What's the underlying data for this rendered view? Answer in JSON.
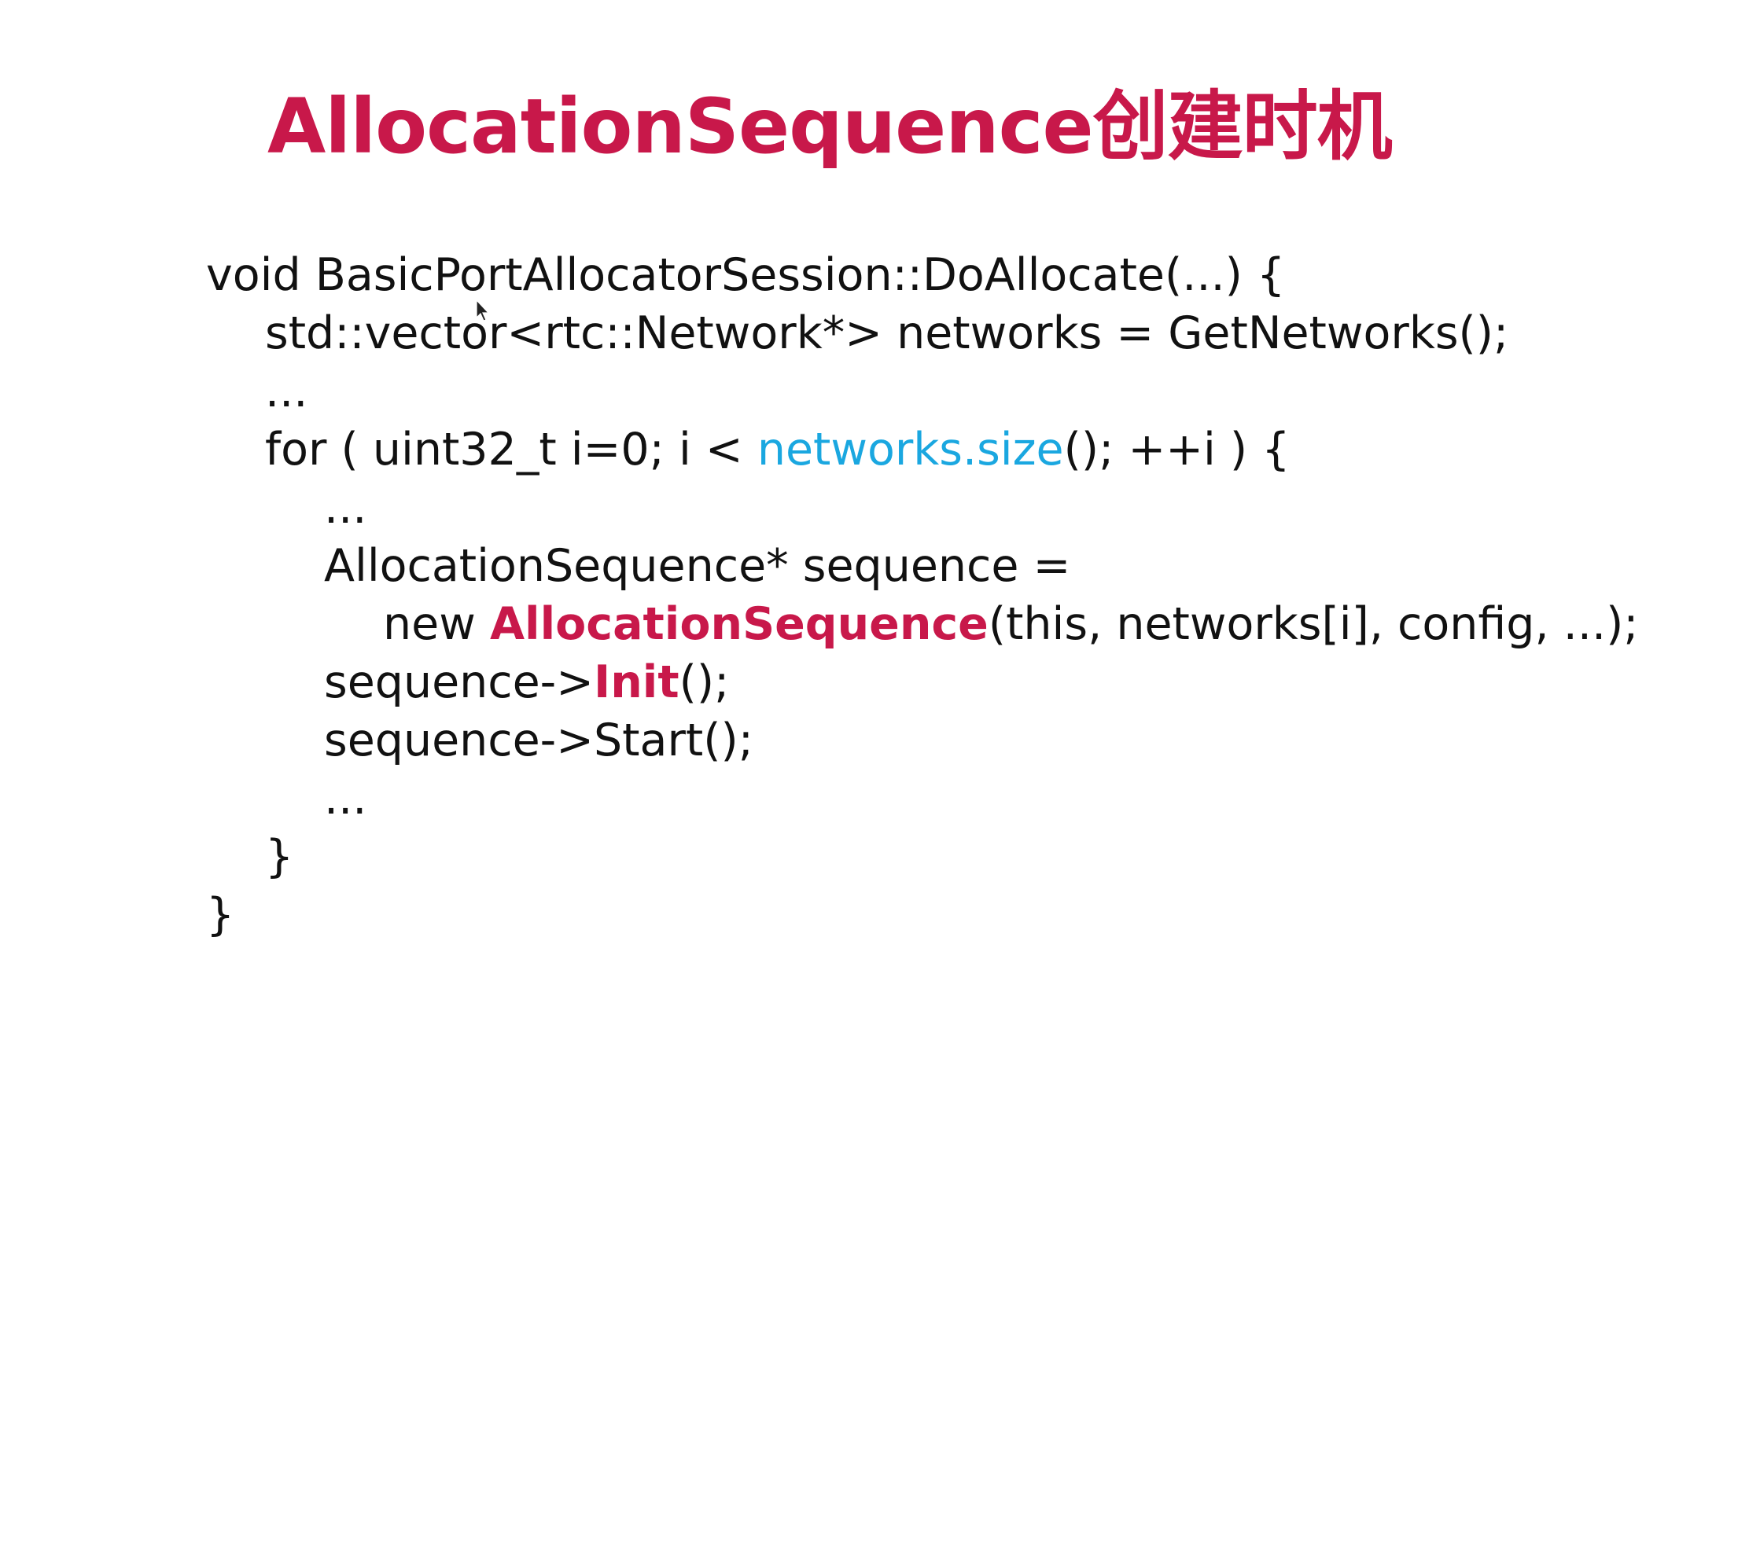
{
  "slide": {
    "title": "AllocationSequence创建时机"
  },
  "code": {
    "line1": "void BasicPortAllocatorSession::DoAllocate(...) {",
    "line2": "std::vector<rtc::Network*> networks = GetNetworks();",
    "line3": "...",
    "line4_prefix": "for ( uint32_t i=0; i < ",
    "line4_highlight": "networks.size",
    "line4_suffix": "(); ++i ) {",
    "line5": "...",
    "line6": "AllocationSequence* sequence =",
    "line7_prefix": "new ",
    "line7_highlight": "AllocationSequence",
    "line7_suffix": "(this, networks[i], config, ...);",
    "line8_prefix": "sequence->",
    "line8_highlight": "Init",
    "line8_suffix": "();",
    "line9": "sequence->Start();",
    "line10": "...",
    "line11": "}",
    "line12": "}"
  },
  "colors": {
    "title": "#c8184a",
    "keyword_highlight": "#c8184a",
    "call_highlight": "#1aa7e0",
    "text": "#111111"
  },
  "icons": {
    "mouse_pointer": "arrow-cursor-icon"
  }
}
